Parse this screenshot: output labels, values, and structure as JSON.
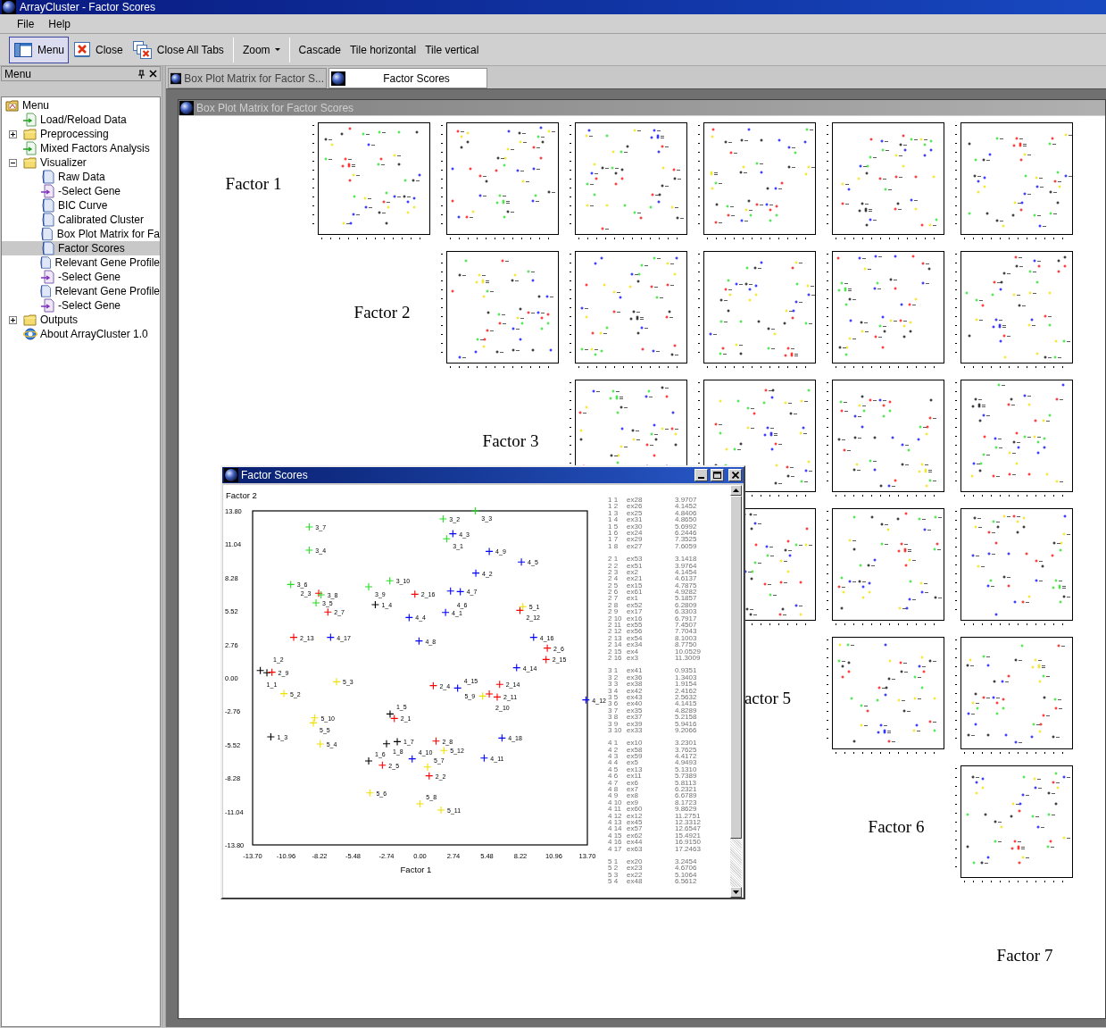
{
  "window": {
    "title": "ArrayCluster - Factor Scores"
  },
  "menu_bar": [
    {
      "label": "File"
    },
    {
      "label": "Help"
    }
  ],
  "toolbar_groups": [
    [
      {
        "label": "Menu",
        "kind": "panel",
        "pressed": true
      },
      {
        "label": "Close",
        "kind": "close",
        "pressed": false
      },
      {
        "label": "Close All Tabs",
        "kind": "close_all",
        "pressed": false
      }
    ],
    [
      {
        "label": "Zoom",
        "kind": "dropdown",
        "pressed": false
      }
    ],
    [
      {
        "label": "Cascade",
        "kind": "text",
        "pressed": false
      },
      {
        "label": "Tile horizontal",
        "kind": "text",
        "pressed": false
      },
      {
        "label": "Tile vertical",
        "kind": "text",
        "pressed": false
      }
    ]
  ],
  "side_panel": {
    "title": "Menu",
    "tree": [
      {
        "label": "Menu",
        "kind": "root",
        "selected": false,
        "children": [
          {
            "label": "Load/Reload Data",
            "kind": "action",
            "selected": false
          },
          {
            "label": "Preprocessing",
            "kind": "folder",
            "expanded": false,
            "selected": false
          },
          {
            "label": "Mixed Factors Analysis",
            "kind": "action",
            "selected": false
          },
          {
            "label": "Visualizer",
            "kind": "folder",
            "expanded": true,
            "selected": false,
            "children": [
              {
                "label": "Raw Data",
                "kind": "view",
                "selected": false
              },
              {
                "label": "-Select Gene",
                "kind": "select",
                "selected": false
              },
              {
                "label": "BIC Curve",
                "kind": "view",
                "selected": false
              },
              {
                "label": "Calibrated Cluster",
                "kind": "view",
                "selected": false
              },
              {
                "label": "Box Plot Matrix for Fa",
                "kind": "view",
                "selected": false
              },
              {
                "label": "Factor Scores",
                "kind": "view",
                "selected": true
              },
              {
                "label": "Relevant Gene Profile",
                "kind": "view",
                "selected": false
              },
              {
                "label": "-Select Gene",
                "kind": "select",
                "selected": false
              },
              {
                "label": "Relevant Gene Profile",
                "kind": "view",
                "selected": false
              },
              {
                "label": "-Select Gene",
                "kind": "select",
                "selected": false
              }
            ]
          },
          {
            "label": "Outputs",
            "kind": "folder",
            "expanded": false,
            "selected": false
          },
          {
            "label": "About ArrayCluster 1.0",
            "kind": "about",
            "selected": false
          }
        ]
      }
    ]
  },
  "tabs": [
    {
      "label": "Box Plot Matrix for Factor S...",
      "selected": false
    },
    {
      "label": "Factor Scores",
      "selected": true
    }
  ],
  "box_plot_matrix": {
    "title": "Box Plot Matrix for Factor Scores",
    "active": false,
    "rows": [
      {
        "kind": "labelled",
        "label": "Factor 1"
      },
      {
        "kind": "labelled",
        "label": "Factor 2"
      },
      {
        "kind": "labelled",
        "label": "Factor 3"
      },
      {
        "kind": "covered"
      },
      {
        "kind": "labelled",
        "label": "actor 5"
      },
      {
        "kind": "labelled",
        "label": "Factor 6"
      },
      {
        "kind": "labelled",
        "label": "Factor 7"
      }
    ]
  },
  "factor_scores_window": {
    "title": "Factor Scores",
    "active": true,
    "chart_data": {
      "type": "scatter",
      "xlabel": "Factor 1",
      "ylabel": "Factor 2",
      "xlim": [
        -13.7,
        13.7
      ],
      "ylim": [
        -13.8,
        13.8
      ],
      "xticks": [
        {
          "value": -13.7,
          "label": "-13.70"
        },
        {
          "value": -10.96,
          "label": "-10.96"
        },
        {
          "value": -8.22,
          "label": "-8.22"
        },
        {
          "value": -5.48,
          "label": "-5.48"
        },
        {
          "value": -2.74,
          "label": "-2.74"
        },
        {
          "value": 0,
          "label": "0.00"
        },
        {
          "value": 2.74,
          "label": "2.74"
        },
        {
          "value": 5.48,
          "label": "5.48"
        },
        {
          "value": 8.22,
          "label": "8.22"
        },
        {
          "value": 10.96,
          "label": "10.96"
        },
        {
          "value": 13.7,
          "label": "13.70"
        }
      ],
      "yticks": [
        {
          "value": 13.8,
          "label": "13.80"
        },
        {
          "value": 11.04,
          "label": "11.04"
        },
        {
          "value": 8.28,
          "label": "8.28"
        },
        {
          "value": 5.52,
          "label": "5.52"
        },
        {
          "value": 2.76,
          "label": "2.76"
        },
        {
          "value": 0,
          "label": "0.00"
        },
        {
          "value": -2.76,
          "label": "-2.76"
        },
        {
          "value": -5.52,
          "label": "-5.52"
        },
        {
          "value": -8.28,
          "label": "-8.28"
        },
        {
          "value": -11.04,
          "label": "-11.04"
        },
        {
          "value": -13.8,
          "label": "-13.80"
        }
      ],
      "series": [
        {
          "color": "#000000",
          "x": [
            -13.07,
            -12.53,
            -12.21,
            -3.66,
            -2.45,
            -4.2,
            -1.86,
            -2.74
          ],
          "values": [
            0.61,
            0.42,
            -4.87,
            6.05,
            -2.98,
            -6.86,
            -5.27,
            -5.44
          ]
        },
        {
          "color": "#ff0000",
          "x": [
            -2.1,
            0.75,
            -8.29,
            1.09,
            -3.08,
            10.42,
            -7.54,
            1.31,
            -12.12,
            5.67,
            6.32,
            8.18,
            -10.34,
            6.52,
            10.32,
            -0.42
          ],
          "values": [
            -3.35,
            -8.09,
            6.99,
            -0.64,
            -7.21,
            2.46,
            5.44,
            -5.22,
            0.47,
            -1.33,
            -1.58,
            5.58,
            3.35,
            -0.54,
            1.52,
            6.91
          ]
        },
        {
          "color": "#22dd22",
          "x": [
            2.18,
            1.89,
            4.52,
            -9.07,
            -8.51,
            -10.58,
            -9.07,
            -8.1,
            -4.2,
            -2.47
          ],
          "values": [
            11.49,
            13.14,
            13.8,
            10.55,
            6.2,
            7.72,
            12.47,
            6.86,
            7.53,
            8.02
          ]
        },
        {
          "color": "#0000ff",
          "x": [
            2.09,
            4.57,
            2.69,
            -0.89,
            8.3,
            2.5,
            3.3,
            -0.08,
            5.67,
            -0.64,
            5.25,
            13.58,
            7.91,
            3.08,
            9.3,
            -7.32,
            6.71
          ],
          "values": [
            5.41,
            8.66,
            11.91,
            4.99,
            9.57,
            7.18,
            7.13,
            3.05,
            10.45,
            -6.69,
            -6.62,
            -1.82,
            0.84,
            -0.84,
            3.35,
            3.35,
            -4.97
          ]
        },
        {
          "color": "#f0e000",
          "x": [
            8.42,
            -11.14,
            -6.83,
            -8.17,
            -8.73,
            -4.1,
            0.62,
            -0.01,
            5.13,
            -8.63,
            1.72,
            1.96
          ],
          "values": [
            5.88,
            -1.3,
            -0.32,
            -5.46,
            -3.72,
            -9.5,
            -7.36,
            -10.41,
            -1.5,
            -3.3,
            -10.92,
            -6.0
          ]
        }
      ],
      "annotations": [
        {
          "x": -13.07,
          "y": 0.61,
          "text": "1_1"
        },
        {
          "x": -12.53,
          "y": 0.42,
          "text": "1_2"
        },
        {
          "x": -12.21,
          "y": -4.87,
          "text": "1_3"
        },
        {
          "x": -3.66,
          "y": 6.05,
          "text": "1_4"
        },
        {
          "x": -2.45,
          "y": -2.98,
          "text": "1_5"
        },
        {
          "x": -4.2,
          "y": -6.86,
          "text": "1_6"
        },
        {
          "x": -1.86,
          "y": -5.27,
          "text": "1_7"
        },
        {
          "x": -2.74,
          "y": -5.44,
          "text": "1_8"
        },
        {
          "x": -2.1,
          "y": -3.35,
          "text": "2_1"
        },
        {
          "x": 0.75,
          "y": -8.09,
          "text": "2_2"
        },
        {
          "x": -8.29,
          "y": 6.99,
          "text": "2_3"
        },
        {
          "x": 1.09,
          "y": -0.64,
          "text": "2_4"
        },
        {
          "x": -3.08,
          "y": -7.21,
          "text": "2_5"
        },
        {
          "x": 10.42,
          "y": 2.46,
          "text": "2_6"
        },
        {
          "x": -7.54,
          "y": 5.44,
          "text": "2_7"
        },
        {
          "x": 1.31,
          "y": -5.22,
          "text": "2_8"
        },
        {
          "x": -12.12,
          "y": 0.47,
          "text": "2_9"
        },
        {
          "x": 5.67,
          "y": -1.33,
          "text": "2_10"
        },
        {
          "x": 6.32,
          "y": -1.58,
          "text": "2_11"
        },
        {
          "x": 8.18,
          "y": 5.58,
          "text": "2_12"
        },
        {
          "x": -10.34,
          "y": 3.35,
          "text": "2_13"
        },
        {
          "x": 6.52,
          "y": -0.54,
          "text": "2_14"
        },
        {
          "x": 10.32,
          "y": 1.52,
          "text": "2_15"
        },
        {
          "x": -0.42,
          "y": 6.91,
          "text": "2_16"
        },
        {
          "x": 2.18,
          "y": 11.49,
          "text": "3_1"
        },
        {
          "x": 1.89,
          "y": 13.14,
          "text": "3_2"
        },
        {
          "x": 4.52,
          "y": 13.8,
          "text": "3_3"
        },
        {
          "x": -9.07,
          "y": 10.55,
          "text": "3_4"
        },
        {
          "x": -8.51,
          "y": 6.2,
          "text": "3_5"
        },
        {
          "x": -10.58,
          "y": 7.72,
          "text": "3_6"
        },
        {
          "x": -9.07,
          "y": 12.47,
          "text": "3_7"
        },
        {
          "x": -8.1,
          "y": 6.86,
          "text": "3_8"
        },
        {
          "x": -4.2,
          "y": 7.53,
          "text": "3_9"
        },
        {
          "x": -2.47,
          "y": 8.02,
          "text": "3_10"
        },
        {
          "x": 2.09,
          "y": 5.41,
          "text": "4_1"
        },
        {
          "x": 4.57,
          "y": 8.66,
          "text": "4_2"
        },
        {
          "x": 2.69,
          "y": 11.91,
          "text": "4_3"
        },
        {
          "x": -0.89,
          "y": 4.99,
          "text": "4_4"
        },
        {
          "x": 8.3,
          "y": 9.57,
          "text": "4_5"
        },
        {
          "x": 2.5,
          "y": 7.18,
          "text": "4_6"
        },
        {
          "x": 3.3,
          "y": 7.13,
          "text": "4_7"
        },
        {
          "x": -0.08,
          "y": 3.05,
          "text": "4_8"
        },
        {
          "x": 5.67,
          "y": 10.45,
          "text": "4_9"
        },
        {
          "x": -0.64,
          "y": -6.69,
          "text": "4_10"
        },
        {
          "x": 5.25,
          "y": -6.62,
          "text": "4_11"
        },
        {
          "x": 13.58,
          "y": -1.82,
          "text": "4_12"
        },
        {
          "x": 7.91,
          "y": 0.84,
          "text": "4_14"
        },
        {
          "x": 3.08,
          "y": -0.84,
          "text": "4_15"
        },
        {
          "x": 9.3,
          "y": 3.35,
          "text": "4_16"
        },
        {
          "x": -7.32,
          "y": 3.35,
          "text": "4_17"
        },
        {
          "x": 6.71,
          "y": -4.97,
          "text": "4_18"
        },
        {
          "x": 8.42,
          "y": 5.88,
          "text": "5_1"
        },
        {
          "x": -11.14,
          "y": -1.3,
          "text": "5_2"
        },
        {
          "x": -6.83,
          "y": -0.32,
          "text": "5_3"
        },
        {
          "x": -8.17,
          "y": -5.46,
          "text": "5_4"
        },
        {
          "x": -8.73,
          "y": -3.72,
          "text": "5_5"
        },
        {
          "x": -4.1,
          "y": -9.5,
          "text": "5_6"
        },
        {
          "x": 0.62,
          "y": -7.36,
          "text": "5_7"
        },
        {
          "x": -0.01,
          "y": -10.41,
          "text": "5_8"
        },
        {
          "x": 5.13,
          "y": -1.5,
          "text": "5_9"
        },
        {
          "x": -8.63,
          "y": -3.3,
          "text": "5_10"
        },
        {
          "x": 1.72,
          "y": -10.92,
          "text": "5_11"
        },
        {
          "x": 1.96,
          "y": -6.0,
          "text": "5_12"
        }
      ]
    },
    "score_list": [
      [
        [
          "1 1",
          "ex28",
          "3.9707"
        ],
        [
          "1 2",
          "ex26",
          "4.1452"
        ],
        [
          "1 3",
          "ex25",
          "4.8406"
        ],
        [
          "1 4",
          "ex31",
          "4.8650"
        ],
        [
          "1 5",
          "ex30",
          "5.6992"
        ],
        [
          "1 6",
          "ex24",
          "6.2446"
        ],
        [
          "1 7",
          "ex29",
          "7.3525"
        ],
        [
          "1 8",
          "ex27",
          "7.6059"
        ]
      ],
      [
        [
          "2 1",
          "ex53",
          "3.1418"
        ],
        [
          "2 2",
          "ex51",
          "3.9764"
        ],
        [
          "2 3",
          "ex2",
          "4.1454"
        ],
        [
          "2 4",
          "ex21",
          "4.6137"
        ],
        [
          "2 5",
          "ex15",
          "4.7875"
        ],
        [
          "2 6",
          "ex61",
          "4.9282"
        ],
        [
          "2 7",
          "ex1",
          "5.1857"
        ],
        [
          "2 8",
          "ex52",
          "6.2809"
        ],
        [
          "2 9",
          "ex17",
          "6.3303"
        ],
        [
          "2 10",
          "ex16",
          "6.7917"
        ],
        [
          "2 11",
          "ex55",
          "7.4507"
        ],
        [
          "2 12",
          "ex56",
          "7.7043"
        ],
        [
          "2 13",
          "ex54",
          "8.1003"
        ],
        [
          "2 14",
          "ex34",
          "8.7750"
        ],
        [
          "2 15",
          "ex4",
          "10.0529"
        ],
        [
          "2 16",
          "ex3",
          "11.3009"
        ]
      ],
      [
        [
          "3 1",
          "ex41",
          "0.9351"
        ],
        [
          "3 2",
          "ex36",
          "1.3403"
        ],
        [
          "3 3",
          "ex38",
          "1.9154"
        ],
        [
          "3 4",
          "ex42",
          "2.4162"
        ],
        [
          "3 5",
          "ex43",
          "2.5632"
        ],
        [
          "3 6",
          "ex40",
          "4.1415"
        ],
        [
          "3 7",
          "ex35",
          "4.8289"
        ],
        [
          "3 8",
          "ex37",
          "5.2158"
        ],
        [
          "3 9",
          "ex39",
          "5.9416"
        ],
        [
          "3 10",
          "ex33",
          "9.2066"
        ]
      ],
      [
        [
          "4 1",
          "ex10",
          "3.2301"
        ],
        [
          "4 2",
          "ex58",
          "3.7625"
        ],
        [
          "4 3",
          "ex59",
          "4.4172"
        ],
        [
          "4 4",
          "ex5",
          "4.9493"
        ],
        [
          "4 5",
          "ex13",
          "5.1310"
        ],
        [
          "4 6",
          "ex11",
          "5.7389"
        ],
        [
          "4 7",
          "ex6",
          "5.8113"
        ],
        [
          "4 8",
          "ex7",
          "6.2321"
        ],
        [
          "4 9",
          "ex8",
          "6.6789"
        ],
        [
          "4 10",
          "ex9",
          "8.1723"
        ],
        [
          "4 11",
          "ex60",
          "9.8629"
        ],
        [
          "4 12",
          "ex12",
          "11.2751"
        ],
        [
          "4 13",
          "ex45",
          "12.3312"
        ],
        [
          "4 14",
          "ex57",
          "12.6547"
        ],
        [
          "4 15",
          "ex62",
          "15.4921"
        ],
        [
          "4 16",
          "ex44",
          "16.9150"
        ],
        [
          "4 17",
          "ex63",
          "17.2463"
        ]
      ],
      [
        [
          "5 1",
          "ex20",
          "3.2454"
        ],
        [
          "5 2",
          "ex23",
          "4.6706"
        ],
        [
          "5 3",
          "ex22",
          "5.1064"
        ],
        [
          "5 4",
          "ex48",
          "6.5612"
        ]
      ]
    ]
  }
}
